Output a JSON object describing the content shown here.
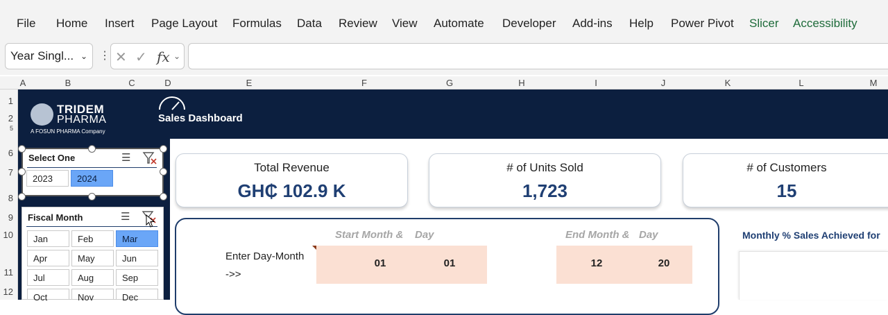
{
  "ribbon": {
    "tabs": [
      {
        "label": "File"
      },
      {
        "label": "Home"
      },
      {
        "label": "Insert"
      },
      {
        "label": "Page Layout"
      },
      {
        "label": "Formulas"
      },
      {
        "label": "Data"
      },
      {
        "label": "Review"
      },
      {
        "label": "View"
      },
      {
        "label": "Automate"
      },
      {
        "label": "Developer"
      },
      {
        "label": "Add-ins"
      },
      {
        "label": "Help"
      },
      {
        "label": "Power Pivot"
      },
      {
        "label": "Slicer"
      },
      {
        "label": "Accessibility"
      }
    ],
    "accent_color": "#1e6b3a"
  },
  "formula_bar": {
    "name_box": "Year Singl...",
    "fx_label": "fx",
    "value": ""
  },
  "columns": [
    "A",
    "B",
    "C",
    "D",
    "E",
    "F",
    "G",
    "H",
    "I",
    "J",
    "K",
    "L",
    "M"
  ],
  "rows": [
    "1",
    "2",
    "5",
    "6",
    "7",
    "8",
    "9",
    "10",
    "11",
    "12"
  ],
  "header": {
    "logo_line1": "TRIDEM",
    "logo_line2": "PHARMA",
    "logo_tagline": "A FOSUN PHARMA Company",
    "title": "Sales Dashboard",
    "background": "#0c1f3f"
  },
  "year_slicer": {
    "title": "Select One",
    "items": [
      {
        "label": "2023",
        "selected": false
      },
      {
        "label": "2024",
        "selected": true
      }
    ]
  },
  "month_slicer": {
    "title": "Fiscal Month",
    "items": [
      {
        "label": "Jan",
        "selected": false
      },
      {
        "label": "Feb",
        "selected": false
      },
      {
        "label": "Mar",
        "selected": true
      },
      {
        "label": "Apr",
        "selected": false
      },
      {
        "label": "May",
        "selected": false
      },
      {
        "label": "Jun",
        "selected": false
      },
      {
        "label": "Jul",
        "selected": false
      },
      {
        "label": "Aug",
        "selected": false
      },
      {
        "label": "Sep",
        "selected": false
      },
      {
        "label": "Oct",
        "selected": false
      },
      {
        "label": "Nov",
        "selected": false
      },
      {
        "label": "Dec",
        "selected": false
      }
    ]
  },
  "kpis": {
    "revenue": {
      "label": "Total Revenue",
      "value": "GH₵ 102.9 K"
    },
    "units": {
      "label": "# of Units Sold",
      "value": "1,723"
    },
    "customers": {
      "label": "# of Customers",
      "value": "15"
    }
  },
  "date_range": {
    "start_label_a": "Start Month &",
    "start_label_b": "Day",
    "end_label_a": "End Month &",
    "end_label_b": "Day",
    "enter_line1": "Enter Day-Month",
    "enter_line2": "->>",
    "start_month": "01",
    "start_day": "01",
    "end_month": "12",
    "end_day": "20"
  },
  "monthly_chart": {
    "title": "Monthly % Sales Achieved for"
  }
}
